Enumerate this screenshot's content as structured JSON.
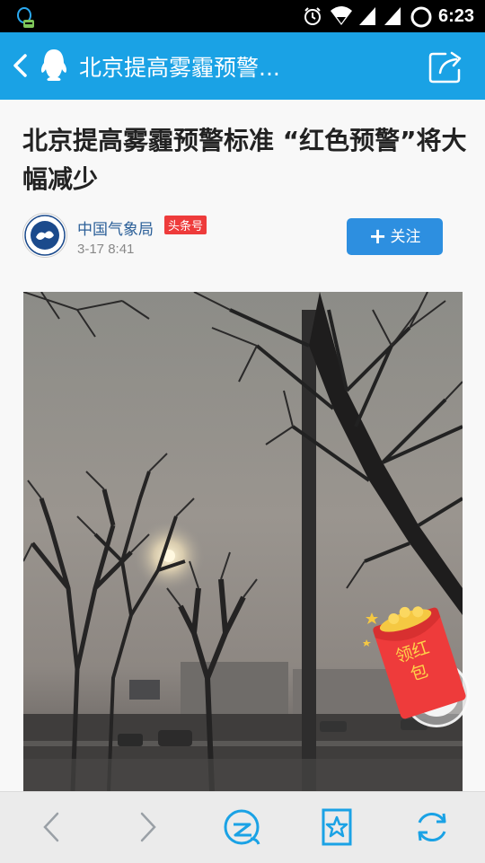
{
  "status_bar": {
    "time": "6:23",
    "icons": [
      "qq-notification-icon",
      "alarm-icon",
      "wifi-icon",
      "signal-icon",
      "battery-icon"
    ]
  },
  "title_bar": {
    "title": "北京提高雾霾预警...",
    "icons": [
      "back-arrow-icon",
      "qq-penguin-icon",
      "share-icon"
    ],
    "color": "#1aa2e5"
  },
  "article": {
    "headline": "北京提高雾霾预警标准 “红色预警”将大幅减少",
    "author": "中国气象局",
    "badge": "头条号",
    "date": "3-17 8:41",
    "follow_label": "关注",
    "image_description": "hazy city street with bare trees"
  },
  "overlay": {
    "red_packet_label": "领红包",
    "red_packet_color": "#ee3b3b"
  },
  "bottom_bar": {
    "icons": [
      "back-icon",
      "forward-icon",
      "qzone-icon",
      "favorite-star-icon",
      "refresh-icon"
    ]
  }
}
